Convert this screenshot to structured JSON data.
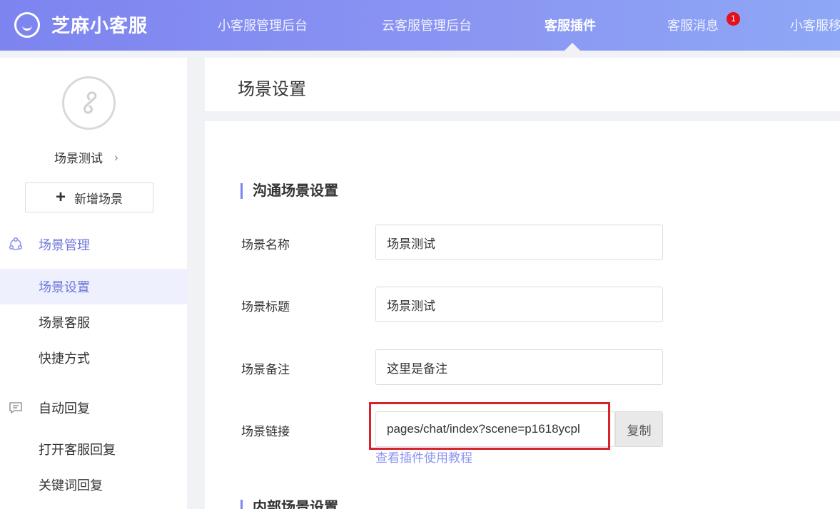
{
  "app": {
    "logo_text": "芝麻小客服"
  },
  "nav": {
    "items": [
      "小客服管理后台",
      "云客服管理后台",
      "客服插件",
      "客服消息",
      "小客服移"
    ],
    "active_index": 2,
    "badge_count": "1"
  },
  "sidebar": {
    "current_scene": "场景测试",
    "add_scene_label": "新增场景",
    "groups": [
      {
        "label": "场景管理",
        "icon": "scene-management-icon"
      },
      {
        "label": "自动回复",
        "icon": "message-icon"
      }
    ],
    "items": [
      "场景设置",
      "场景客服",
      "快捷方式",
      "打开客服回复",
      "关键词回复"
    ],
    "active_item": "场景设置"
  },
  "page": {
    "title": "场景设置",
    "section_comm": "沟通场景设置",
    "section_internal": "内部场景设置",
    "fields": {
      "name_label": "场景名称",
      "name_value": "场景测试",
      "title_label": "场景标题",
      "title_value": "场景测试",
      "note_label": "场景备注",
      "note_value": "这里是备注",
      "link_label": "场景链接",
      "link_value": "pages/chat/index?scene=p1618ycpl"
    },
    "copy_label": "复制",
    "tutorial_link": "查看插件使用教程"
  },
  "colors": {
    "accent": "#7d84f0",
    "active_text": "#6e76d9",
    "highlight": "#d6232c",
    "badge": "#e60f1c"
  }
}
